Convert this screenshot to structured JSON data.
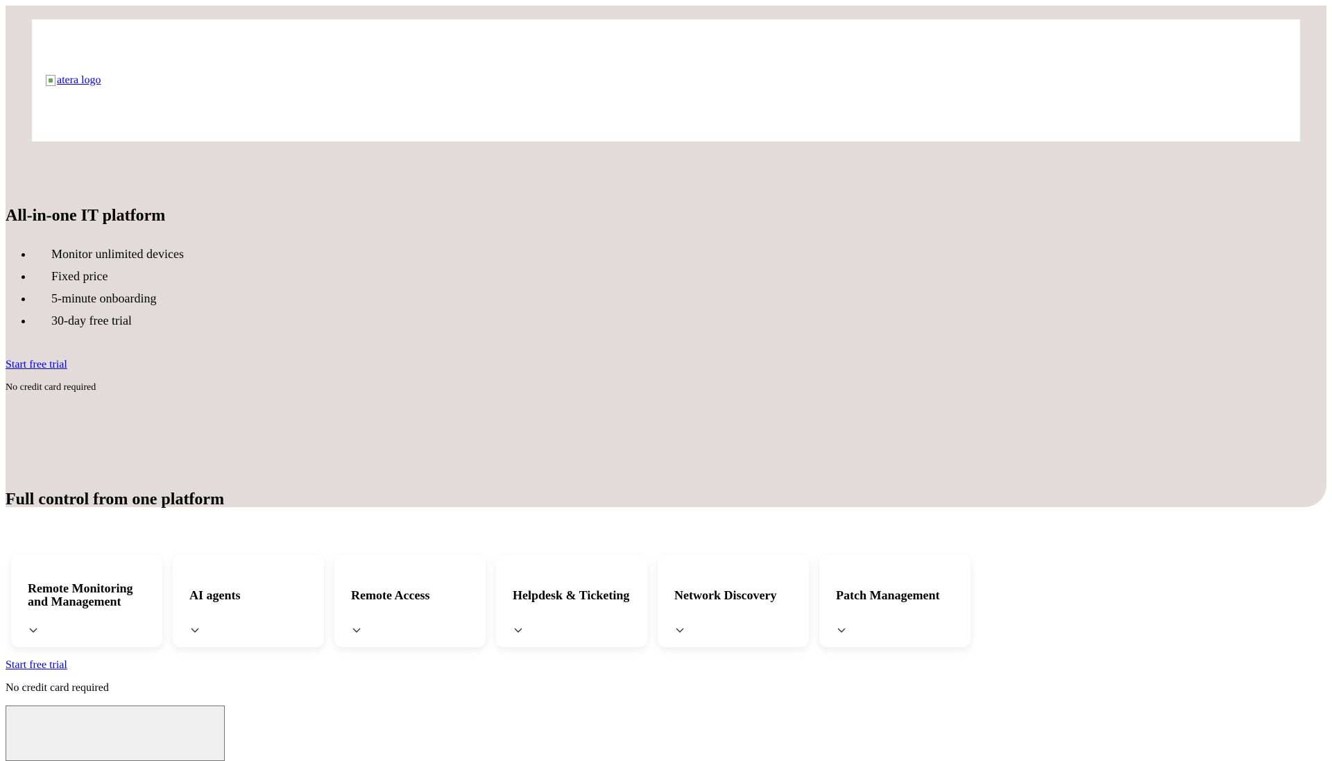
{
  "header": {
    "logo_alt": "atera logo"
  },
  "hero": {
    "title": "All-in-one IT platform",
    "features": [
      "Monitor unlimited devices",
      "Fixed price",
      "5-minute onboarding",
      "30-day free trial"
    ],
    "cta_label": "Start free trial",
    "cta_note": "No credit card required"
  },
  "platform": {
    "title": "Full control from one platform",
    "cards": [
      {
        "title": "Remote Monitoring and Management"
      },
      {
        "title": "AI agents"
      },
      {
        "title": "Remote Access"
      },
      {
        "title": "Helpdesk & Ticketing"
      },
      {
        "title": "Network Discovery"
      },
      {
        "title": "Patch Management"
      }
    ],
    "cta_label": "Start free trial",
    "cta_note": "No credit card required"
  },
  "colors": {
    "hero_background": "#e3dbda",
    "link": "#0000ee"
  },
  "icons": {
    "card_expand": "chevron-down-icon",
    "logo": "broken-image-icon"
  }
}
